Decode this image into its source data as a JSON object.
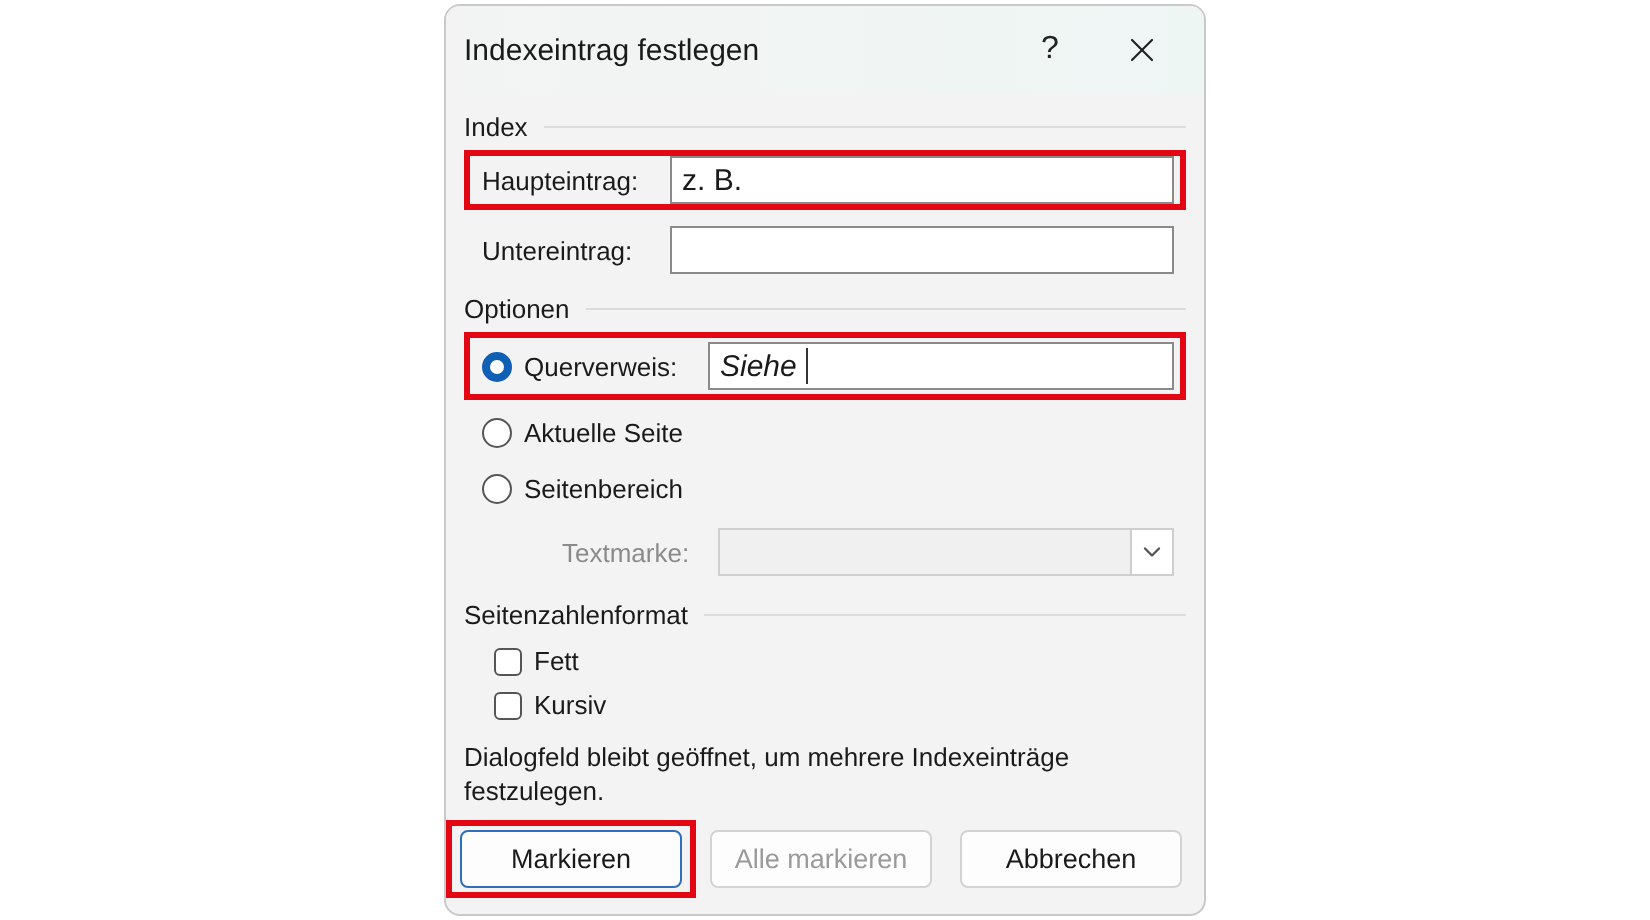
{
  "window": {
    "title": "Indexeintrag festlegen",
    "help_button": "?"
  },
  "index": {
    "heading": "Index",
    "fields": [
      {
        "label": "Haupteintrag:",
        "value": "z. B.",
        "highlighted": true
      },
      {
        "label": "Untereintrag:",
        "highlighted": false
      }
    ]
  },
  "options": {
    "heading": "Optionen",
    "items": [
      {
        "kind": "field-radio",
        "label": "Querverweis:",
        "selected": true,
        "value": "Siehe",
        "highlighted": true
      },
      {
        "kind": "radio",
        "label": "Aktuelle Seite",
        "selected": false,
        "highlighted": false
      },
      {
        "kind": "radio",
        "label": "Seitenbereich",
        "selected": false,
        "highlighted": false
      }
    ],
    "bookmark": {
      "label": "Textmarke:",
      "disabled": true
    }
  },
  "page_number_format": {
    "heading": "Seitenzahlenformat",
    "checkboxes": [
      {
        "label": "Fett",
        "checked": false
      },
      {
        "label": "Kursiv",
        "checked": false
      }
    ]
  },
  "note": "Dialogfeld bleibt geöffnet, um mehrere Indexeinträge festzulegen.",
  "buttons": [
    {
      "label": "Markieren",
      "disabled": false,
      "default": true,
      "highlighted": true
    },
    {
      "label": "Alle markieren",
      "disabled": true,
      "default": false,
      "highlighted": false
    },
    {
      "label": "Abbrechen",
      "disabled": false,
      "default": false,
      "highlighted": false
    }
  ]
}
